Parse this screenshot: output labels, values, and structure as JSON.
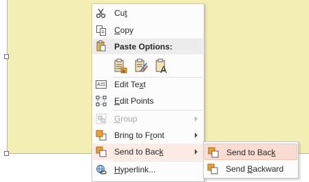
{
  "context_menu": {
    "items": [
      {
        "label_pre": "Cu",
        "label_u": "t",
        "label_post": "",
        "icon": "scissors-icon"
      },
      {
        "label_pre": "",
        "label_u": "C",
        "label_post": "opy",
        "icon": "copy-icon"
      },
      {
        "label": "Paste Options:",
        "icon": "clipboard-icon"
      },
      {
        "label_pre": "Edit Te",
        "label_u": "x",
        "label_post": "t",
        "icon": "edit-text-icon"
      },
      {
        "label_pre": "",
        "label_u": "E",
        "label_post": "dit Points",
        "icon": "edit-points-icon"
      },
      {
        "label_pre": "",
        "label_u": "G",
        "label_post": "roup",
        "icon": "group-icon"
      },
      {
        "label_pre": "Bring to F",
        "label_u": "r",
        "label_post": "ont",
        "icon": "bring-to-front-icon"
      },
      {
        "label_pre": "Send to Bac",
        "label_u": "k",
        "label_post": "",
        "icon": "send-to-back-icon"
      },
      {
        "label_pre": "",
        "label_u": "H",
        "label_post": "yperlink...",
        "icon": "hyperlink-icon"
      }
    ],
    "paste_options": [
      "paste-keep-formatting-icon",
      "paste-picture-icon",
      "paste-keep-text-only-icon"
    ]
  },
  "submenu": {
    "items": [
      {
        "label_pre": "Send to Bac",
        "label_u": "k",
        "label_post": "",
        "icon": "send-to-back-icon"
      },
      {
        "label_pre": "Send ",
        "label_u": "B",
        "label_post": "ackward",
        "icon": "send-backward-icon"
      }
    ]
  },
  "colors": {
    "shape_fill": "#f3efb4",
    "highlight": "#fadcd2",
    "icon_orange": "#f0a030"
  }
}
